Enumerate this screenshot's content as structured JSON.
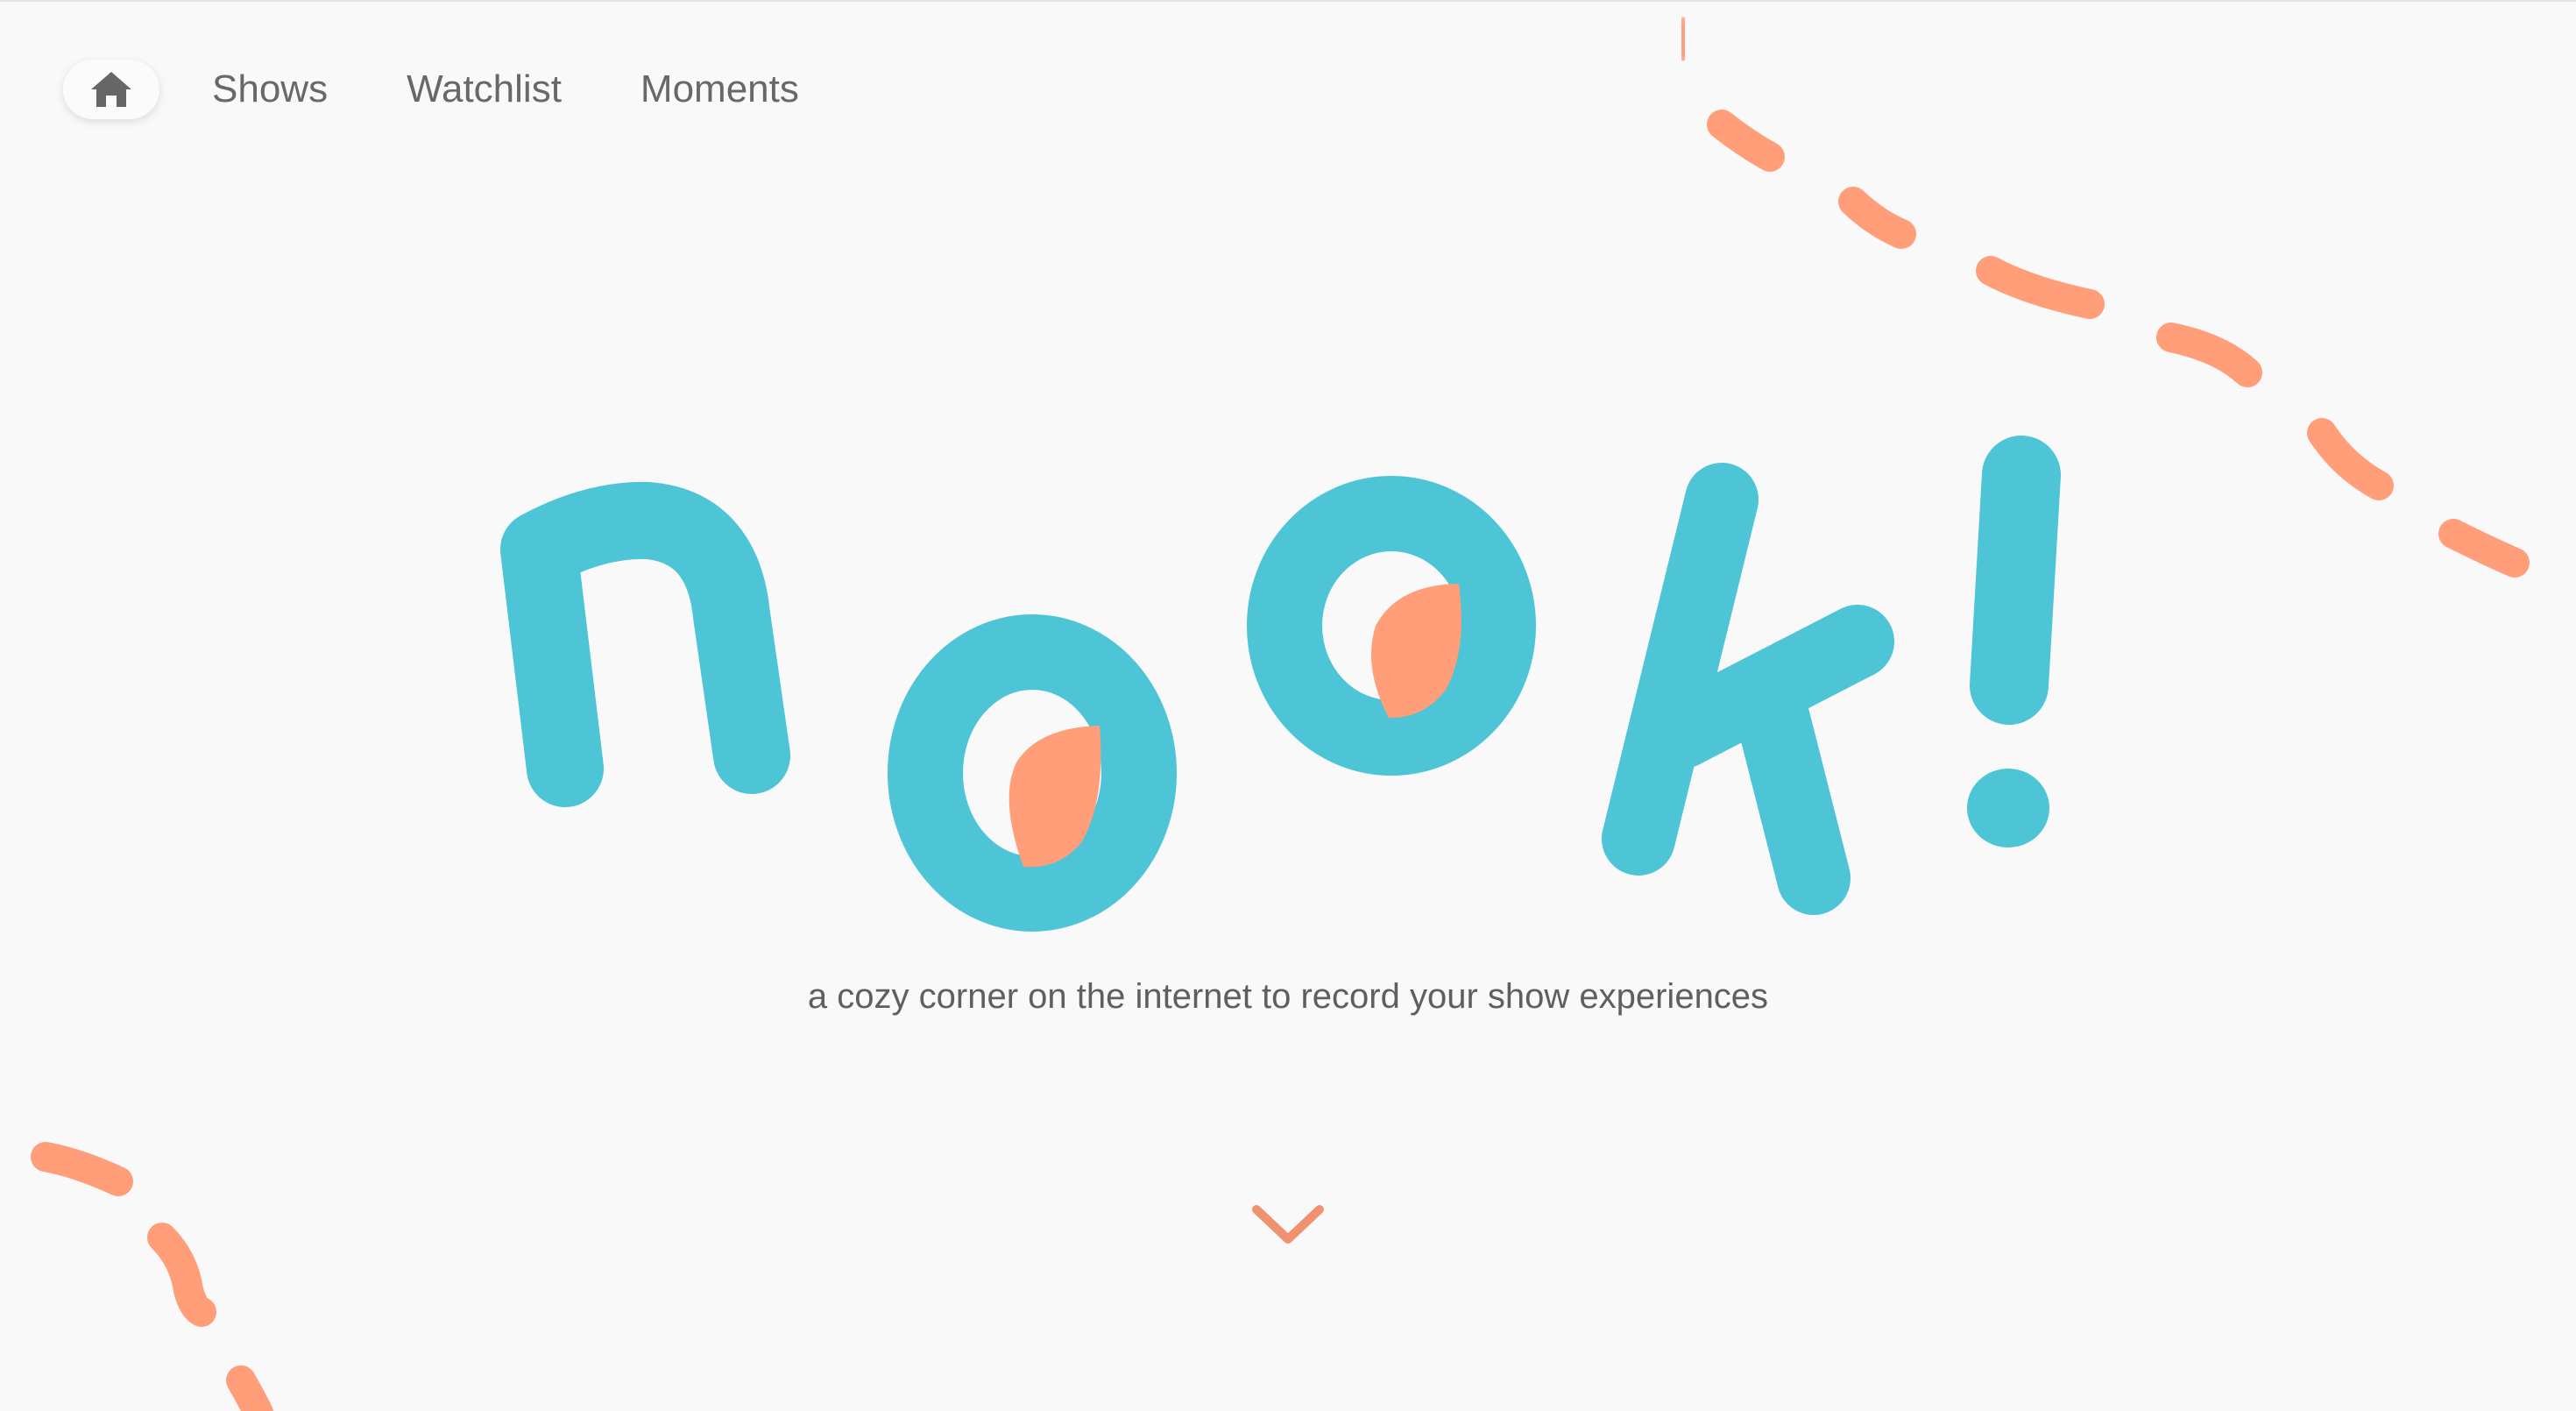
{
  "nav": {
    "home_icon": "home-icon",
    "links": [
      {
        "label": "Shows"
      },
      {
        "label": "Watchlist"
      },
      {
        "label": "Moments"
      }
    ]
  },
  "hero": {
    "logo_text": "nook!",
    "tagline": "a cozy corner on the internet to record your show experiences",
    "scroll_icon": "chevron-down-icon"
  },
  "colors": {
    "background": "#f9f9f9",
    "brand_teal": "#4ec4d7",
    "accent_coral": "#ff9e79",
    "text_gray": "#686868"
  }
}
